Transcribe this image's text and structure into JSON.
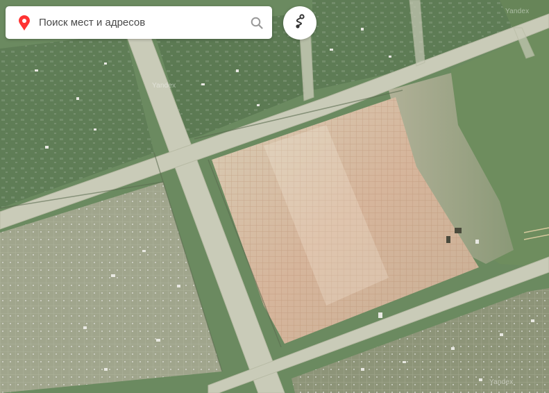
{
  "search": {
    "placeholder": "Поиск мест и адресов",
    "value": ""
  },
  "icons": {
    "location": "location-pin-icon",
    "search": "search-icon",
    "route": "route-icon"
  },
  "watermarks": [
    "Yandex",
    "Yandex",
    "Yandex"
  ],
  "colors": {
    "pin": "#f43",
    "search_icon": "#999999",
    "route_icon": "#333333"
  }
}
